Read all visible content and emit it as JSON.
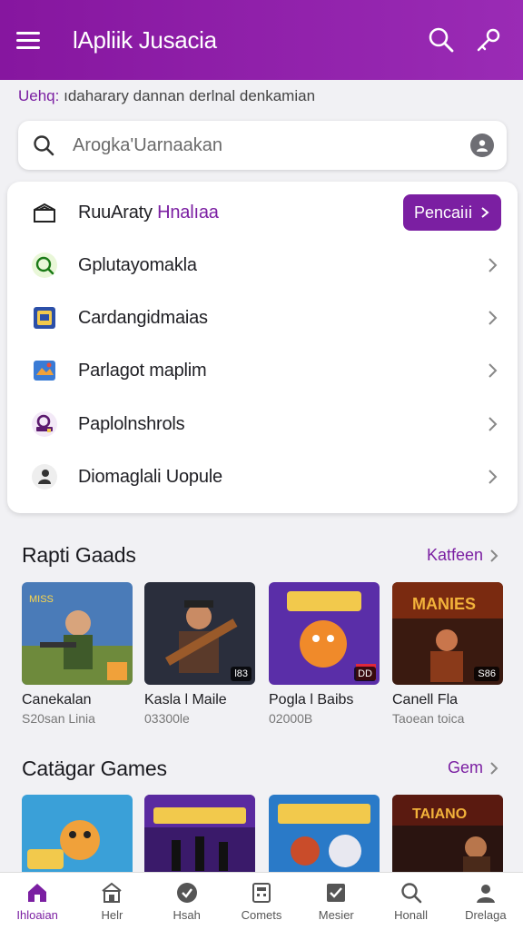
{
  "appbar": {
    "title": "lApliik Jusacia",
    "bg": "#8a1aa3"
  },
  "subtitle": {
    "accent": "Uehq:",
    "text": "ıdaharary  dannan derlnal denkamian"
  },
  "search": {
    "placeholder": "Arogka'Uarnaakan",
    "value": ""
  },
  "menu": {
    "items": [
      {
        "label": "RuuAraty",
        "highlight": "Hnalıaa",
        "icon": "box-icon",
        "action": "Pencaiıi"
      },
      {
        "label": "Gplutayomakla",
        "icon": "search-icon"
      },
      {
        "label": "Cardangidmaias",
        "icon": "card-icon"
      },
      {
        "label": "Parlagot maplim",
        "icon": "map-icon"
      },
      {
        "label": "Paplolnshrols",
        "icon": "controller-icon"
      },
      {
        "label": "Diomaglali Uopule",
        "icon": "person-icon"
      }
    ]
  },
  "section1": {
    "title": "Rapti Gaads",
    "link": "Katfeen",
    "games": [
      {
        "title": "Canekalan",
        "sub": "S20san Linia",
        "badge": ""
      },
      {
        "title": "Kasla l Maile",
        "sub": "03300le",
        "badge": "l83"
      },
      {
        "title": "Pogla l Baibs",
        "sub": "02000B",
        "badge": "DD"
      },
      {
        "title": "Canell Fla",
        "sub": "Taoean toica",
        "badge": "S86"
      }
    ]
  },
  "section2": {
    "title": "Catägar Games",
    "link": "Gem"
  },
  "nav": {
    "items": [
      {
        "label": "Ihloaian",
        "icon": "home-icon",
        "active": true
      },
      {
        "label": "Helr",
        "icon": "building-icon",
        "active": false
      },
      {
        "label": "Hsah",
        "icon": "check-circle-icon",
        "active": false
      },
      {
        "label": "Comets",
        "icon": "calculator-icon",
        "active": false
      },
      {
        "label": "Mesier",
        "icon": "checkbox-icon",
        "active": false
      },
      {
        "label": "Honall",
        "icon": "search-icon",
        "active": false
      },
      {
        "label": "Drelaga",
        "icon": "user-icon",
        "active": false
      }
    ]
  },
  "colors": {
    "accent": "#7b1fa2",
    "appbar": "#8a1aa3"
  }
}
